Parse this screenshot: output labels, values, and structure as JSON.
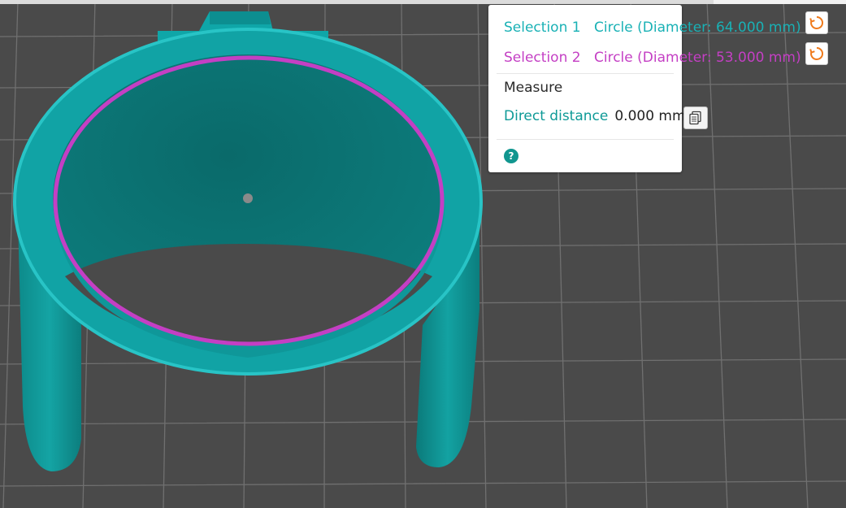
{
  "colors": {
    "background": "#4a4a4a",
    "grid": "#6e6e6e",
    "model": "#0f7f7f",
    "model_light": "#13a9aa",
    "selection_1": "#19b1b5",
    "selection_2": "#c43fc4",
    "reset_icon": "#f07b1c",
    "accent": "#0e9a97"
  },
  "measure_panel": {
    "selections": [
      {
        "label": "Selection 1",
        "value": "Circle (Diameter: 64.000 mm)",
        "reset_icon": "reset-icon"
      },
      {
        "label": "Selection 2",
        "value": "Circle (Diameter: 53.000 mm)",
        "reset_icon": "reset-icon"
      }
    ],
    "measure_title": "Measure",
    "direct_distance_label": "Direct distance",
    "direct_distance_value": "0.000 mm",
    "copy_icon": "copy-icon",
    "help_icon": "?"
  }
}
